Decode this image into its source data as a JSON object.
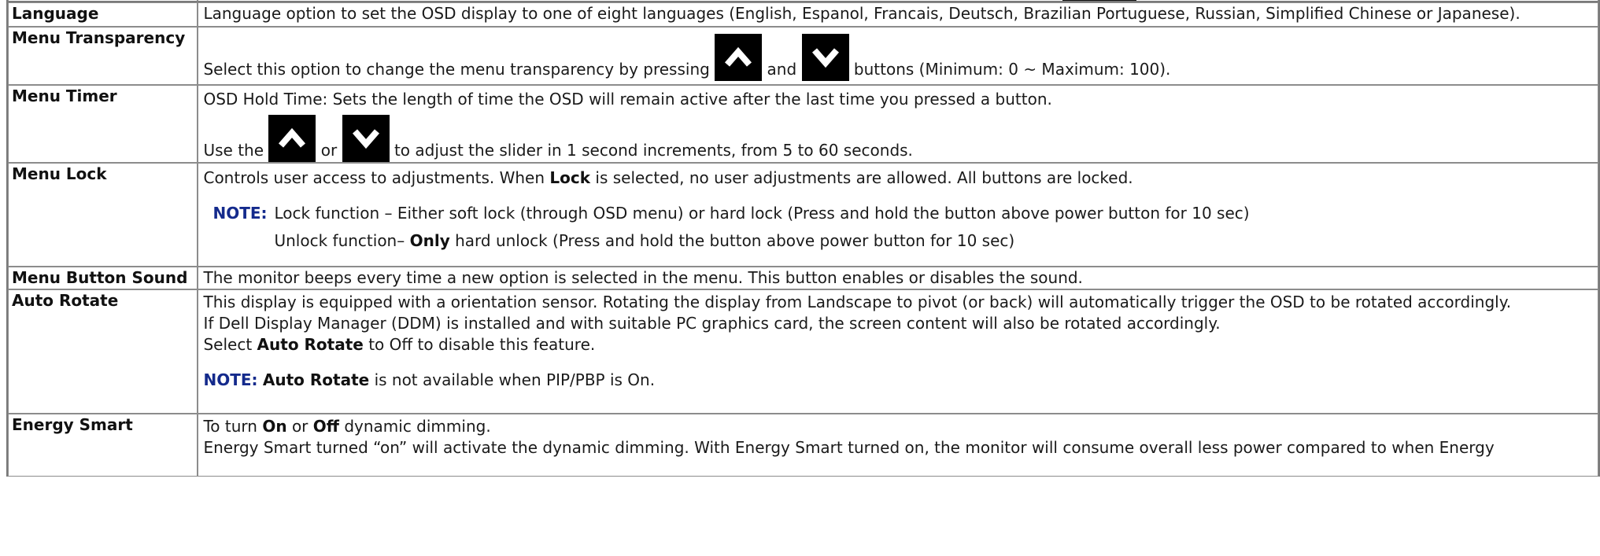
{
  "rows": {
    "language": {
      "label": "Language",
      "text": "Language option to set the OSD display to one of eight languages (English, Espanol, Francais, Deutsch, Brazilian Portuguese, Russian, Simplified Chinese or Japanese)."
    },
    "menu_transparency": {
      "label": "Menu Transparency",
      "text_before": "Select this option to change the menu transparency by pressing",
      "and_word": "and",
      "text_after": "buttons (Minimum: 0 ~ Maximum: 100)."
    },
    "menu_timer": {
      "label": "Menu Timer",
      "line1": "OSD Hold Time: Sets the length of time the OSD will remain active after the last time you pressed a button.",
      "use_the": "Use the",
      "or_word": "or",
      "line2_after": "to adjust the slider in 1 second increments, from 5 to 60 seconds."
    },
    "menu_lock": {
      "label": "Menu Lock",
      "line1_a": "Controls user access to adjustments. When",
      "line1_bold": "Lock",
      "line1_b": "is selected, no user adjustments are allowed. All buttons are locked.",
      "note_label": "NOTE:",
      "note_line1": "Lock function – Either soft lock (through OSD menu) or hard lock (Press and hold the button above power button for 10 sec)",
      "note_line2_a": "Unlock function–",
      "note_line2_bold": "Only",
      "note_line2_b": "hard unlock (Press and hold the button above power button for 10 sec)"
    },
    "menu_button_sound": {
      "label": "Menu Button Sound",
      "text": "The monitor beeps every time a new option is selected in the menu. This button enables or disables the sound."
    },
    "auto_rotate": {
      "label": "Auto Rotate",
      "line1": "This display is equipped with a orientation sensor. Rotating the display from Landscape to pivot (or back) will automatically trigger the OSD to be rotated accordingly.",
      "line2": "If Dell Display Manager (DDM) is installed and with suitable PC graphics card, the screen content will also be rotated accordingly.",
      "line3_a": "Select",
      "line3_bold": "Auto Rotate",
      "line3_b": "to Off to disable this feature.",
      "note_label": "NOTE:",
      "note_bold": "Auto Rotate",
      "note_text": "is not available when PIP/PBP is On."
    },
    "energy_smart": {
      "label": "Energy Smart",
      "line1_a": "To turn",
      "line1_on": "On",
      "line1_or": "or",
      "line1_off": "Off",
      "line1_b": "dynamic dimming.",
      "line2": "Energy Smart turned  “on” will activate the dynamic dimming. With Energy Smart turned on, the monitor will consume overall less power compared to when Energy"
    }
  },
  "icons": {
    "up": "chevron-up-icon",
    "down": "chevron-down-icon"
  }
}
